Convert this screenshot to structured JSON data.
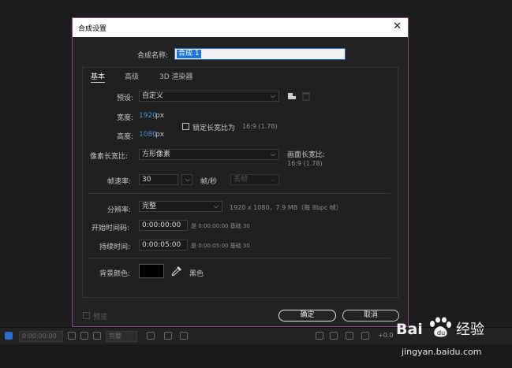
{
  "dialog": {
    "title": "合成设置",
    "close_glyph": "✕",
    "name_label": "合成名称:",
    "name_value": "合成 1",
    "tabs": [
      {
        "label": "基本",
        "active": true
      },
      {
        "label": "高级",
        "active": false
      },
      {
        "label": "3D 渲染器",
        "active": false
      }
    ],
    "preset_label": "预设:",
    "preset_value": "自定义",
    "width_label": "宽度:",
    "width_value": "1920",
    "height_label": "高度:",
    "height_value": "1080",
    "px_unit": "px",
    "lock_ratio_label": "锁定长宽比为",
    "lock_ratio_value": "16:9 (1.78)",
    "pixel_aspect_label": "像素长宽比:",
    "pixel_aspect_value": "方形像素",
    "frame_aspect_label": "画面长宽比:",
    "frame_aspect_value": "16:9 (1.78)",
    "frame_rate_label": "帧速率:",
    "frame_rate_value": "30",
    "fps_label": "帧/秒",
    "drop_frame_value": "丢帧",
    "resolution_label": "分辨率:",
    "resolution_value": "完整",
    "resolution_info": "1920 x 1080，7.9 MB（每 8bpc 帧）",
    "start_tc_label": "开始时间码:",
    "start_tc_value": "0:00:00:00",
    "start_tc_info": "是 0:00:00:00  基础 30",
    "duration_label": "持续时间:",
    "duration_value": "0:00:05:00",
    "duration_info": "是 0:00:05:00  基础 30",
    "bg_color_label": "背景颜色:",
    "bg_color_name": "黑色",
    "bg_color_hex": "#000000",
    "preview_label": "预览",
    "ok_label": "确定",
    "cancel_label": "取消"
  },
  "background": {
    "timecode": "0:00:00:00",
    "quality": "完整",
    "zoom": "+0.0"
  },
  "watermark": {
    "brand": "Bai du 经验",
    "url": "jingyan.baidu.com"
  }
}
